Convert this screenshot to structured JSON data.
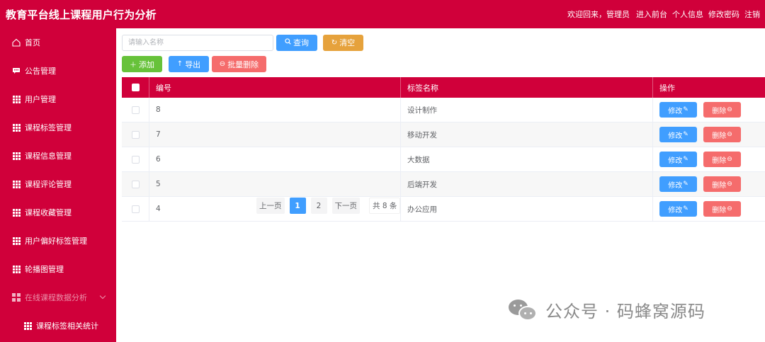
{
  "header": {
    "title": "教育平台线上课程用户行为分析",
    "welcome": "欢迎回来，管理员",
    "links": [
      "进入前台",
      "个人信息",
      "修改密码",
      "注销"
    ]
  },
  "sidebar": {
    "items": [
      {
        "label": "首页",
        "icon": "home-icon"
      },
      {
        "label": "公告管理",
        "icon": "message-icon"
      },
      {
        "label": "用户管理",
        "icon": "grid-icon"
      },
      {
        "label": "课程标签管理",
        "icon": "grid-icon"
      },
      {
        "label": "课程信息管理",
        "icon": "grid-icon"
      },
      {
        "label": "课程评论管理",
        "icon": "grid-icon"
      },
      {
        "label": "课程收藏管理",
        "icon": "grid-icon"
      },
      {
        "label": "用户偏好标签管理",
        "icon": "grid-icon"
      },
      {
        "label": "轮播图管理",
        "icon": "grid-icon"
      },
      {
        "label": "在线课程数据分析",
        "icon": "menu-icon"
      },
      {
        "label": "课程标签相关统计",
        "icon": "grid-icon"
      }
    ]
  },
  "search": {
    "placeholder": "请输入名称",
    "query_label": "查询",
    "clear_label": "清空"
  },
  "actions": {
    "add_label": "添加",
    "export_label": "导出",
    "batch_delete_label": "批量删除"
  },
  "table": {
    "columns": [
      "编号",
      "标签名称",
      "操作"
    ],
    "rows": [
      {
        "id": "8",
        "name": "设计制作"
      },
      {
        "id": "7",
        "name": "移动开发"
      },
      {
        "id": "6",
        "name": "大数据"
      },
      {
        "id": "5",
        "name": "后端开发"
      },
      {
        "id": "4",
        "name": "办公应用"
      }
    ],
    "edit_label": "修改",
    "delete_label": "删除"
  },
  "pagination": {
    "prev": "上一页",
    "pages": [
      "1",
      "2"
    ],
    "current": "1",
    "next": "下一页",
    "total": "共 8 条"
  },
  "watermark": {
    "text": "公众号 · 码蜂窝源码"
  },
  "colors": {
    "brand": "#d0003a",
    "primary": "#409eff",
    "warning": "#e6a23c",
    "success": "#67c23a",
    "danger": "#f56c6c"
  }
}
